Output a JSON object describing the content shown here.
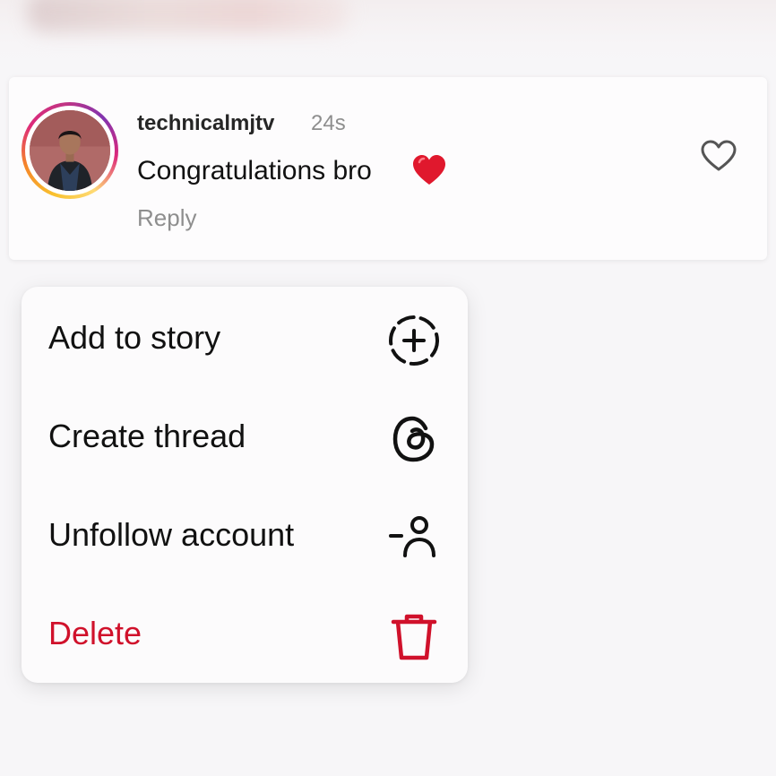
{
  "comment": {
    "username": "technicalmjtv",
    "time": "24s",
    "text": "Congratulations bro",
    "emoji": "heart-emoji",
    "reply_label": "Reply",
    "like_icon": "heart-outline-icon"
  },
  "menu": {
    "items": [
      {
        "label": "Add to story",
        "icon": "add-story-icon"
      },
      {
        "label": "Create thread",
        "icon": "threads-icon"
      },
      {
        "label": "Unfollow account",
        "icon": "unfollow-icon"
      },
      {
        "label": "Delete",
        "icon": "trash-icon",
        "danger": true
      }
    ]
  },
  "colors": {
    "danger": "#d0112b",
    "muted_text": "#8e8e8e",
    "heart_emoji": "#e0182d"
  }
}
